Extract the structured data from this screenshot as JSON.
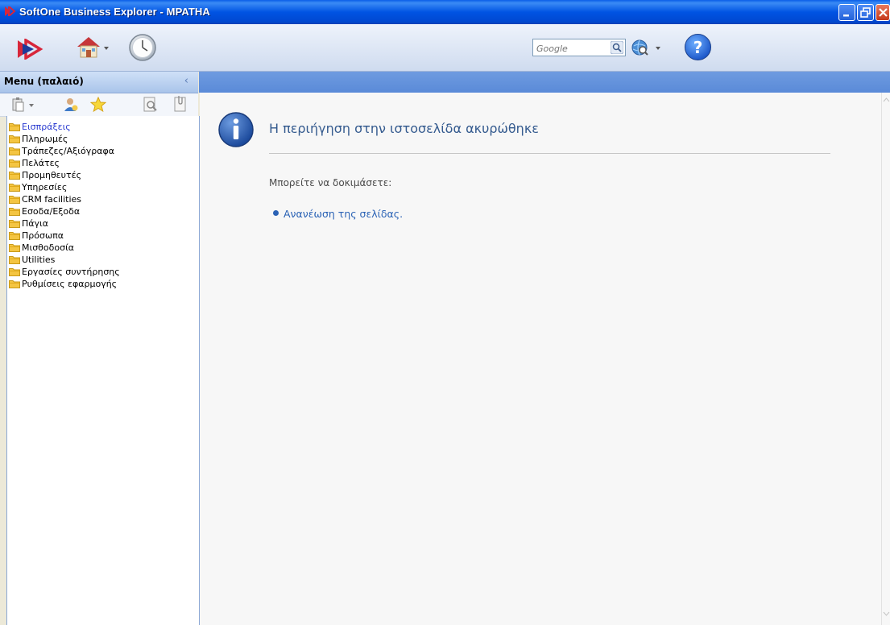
{
  "window": {
    "title": "SoftOne Business Explorer - ΜΡΑΤΗΑ"
  },
  "toolbar": {
    "icons": [
      "softone-logo-icon",
      "home-icon",
      "clock-icon",
      "google-search-icon",
      "world-search-icon",
      "help-icon"
    ],
    "search": {
      "placeholder": "Google",
      "value": ""
    }
  },
  "left_panel": {
    "title": "Menu (παλαιό)",
    "tools": [
      "clipboard-icon",
      "user-icon",
      "star-icon",
      "search-doc-icon",
      "clip-doc-icon"
    ],
    "items": [
      {
        "label": "Εισπράξεις",
        "active": true
      },
      {
        "label": "Πληρωμές"
      },
      {
        "label": "Τράπεζες/Αξιόγραφα"
      },
      {
        "label": "Πελάτες"
      },
      {
        "label": "Προμηθευτές"
      },
      {
        "label": "Υπηρεσίες"
      },
      {
        "label": "CRM facilities"
      },
      {
        "label": "Εσοδα/Εξοδα"
      },
      {
        "label": "Πάγια"
      },
      {
        "label": "Πρόσωπα"
      },
      {
        "label": "Μισθοδοσία"
      },
      {
        "label": "Utilities"
      },
      {
        "label": "Εργασίες συντήρησης"
      },
      {
        "label": "Ρυθμίσεις εφαρμογής"
      }
    ]
  },
  "content": {
    "message_title": "Η περιήγηση στην ιστοσελίδα ακυρώθηκε",
    "try_text": "Μπορείτε να δοκιμάσετε:",
    "refresh_link": "Ανανέωση της σελίδας."
  },
  "colors": {
    "titlebar": "#0054e3",
    "accent_blue": "#5a8ad8",
    "link": "#2a62b5",
    "folder": "#f4c542"
  }
}
